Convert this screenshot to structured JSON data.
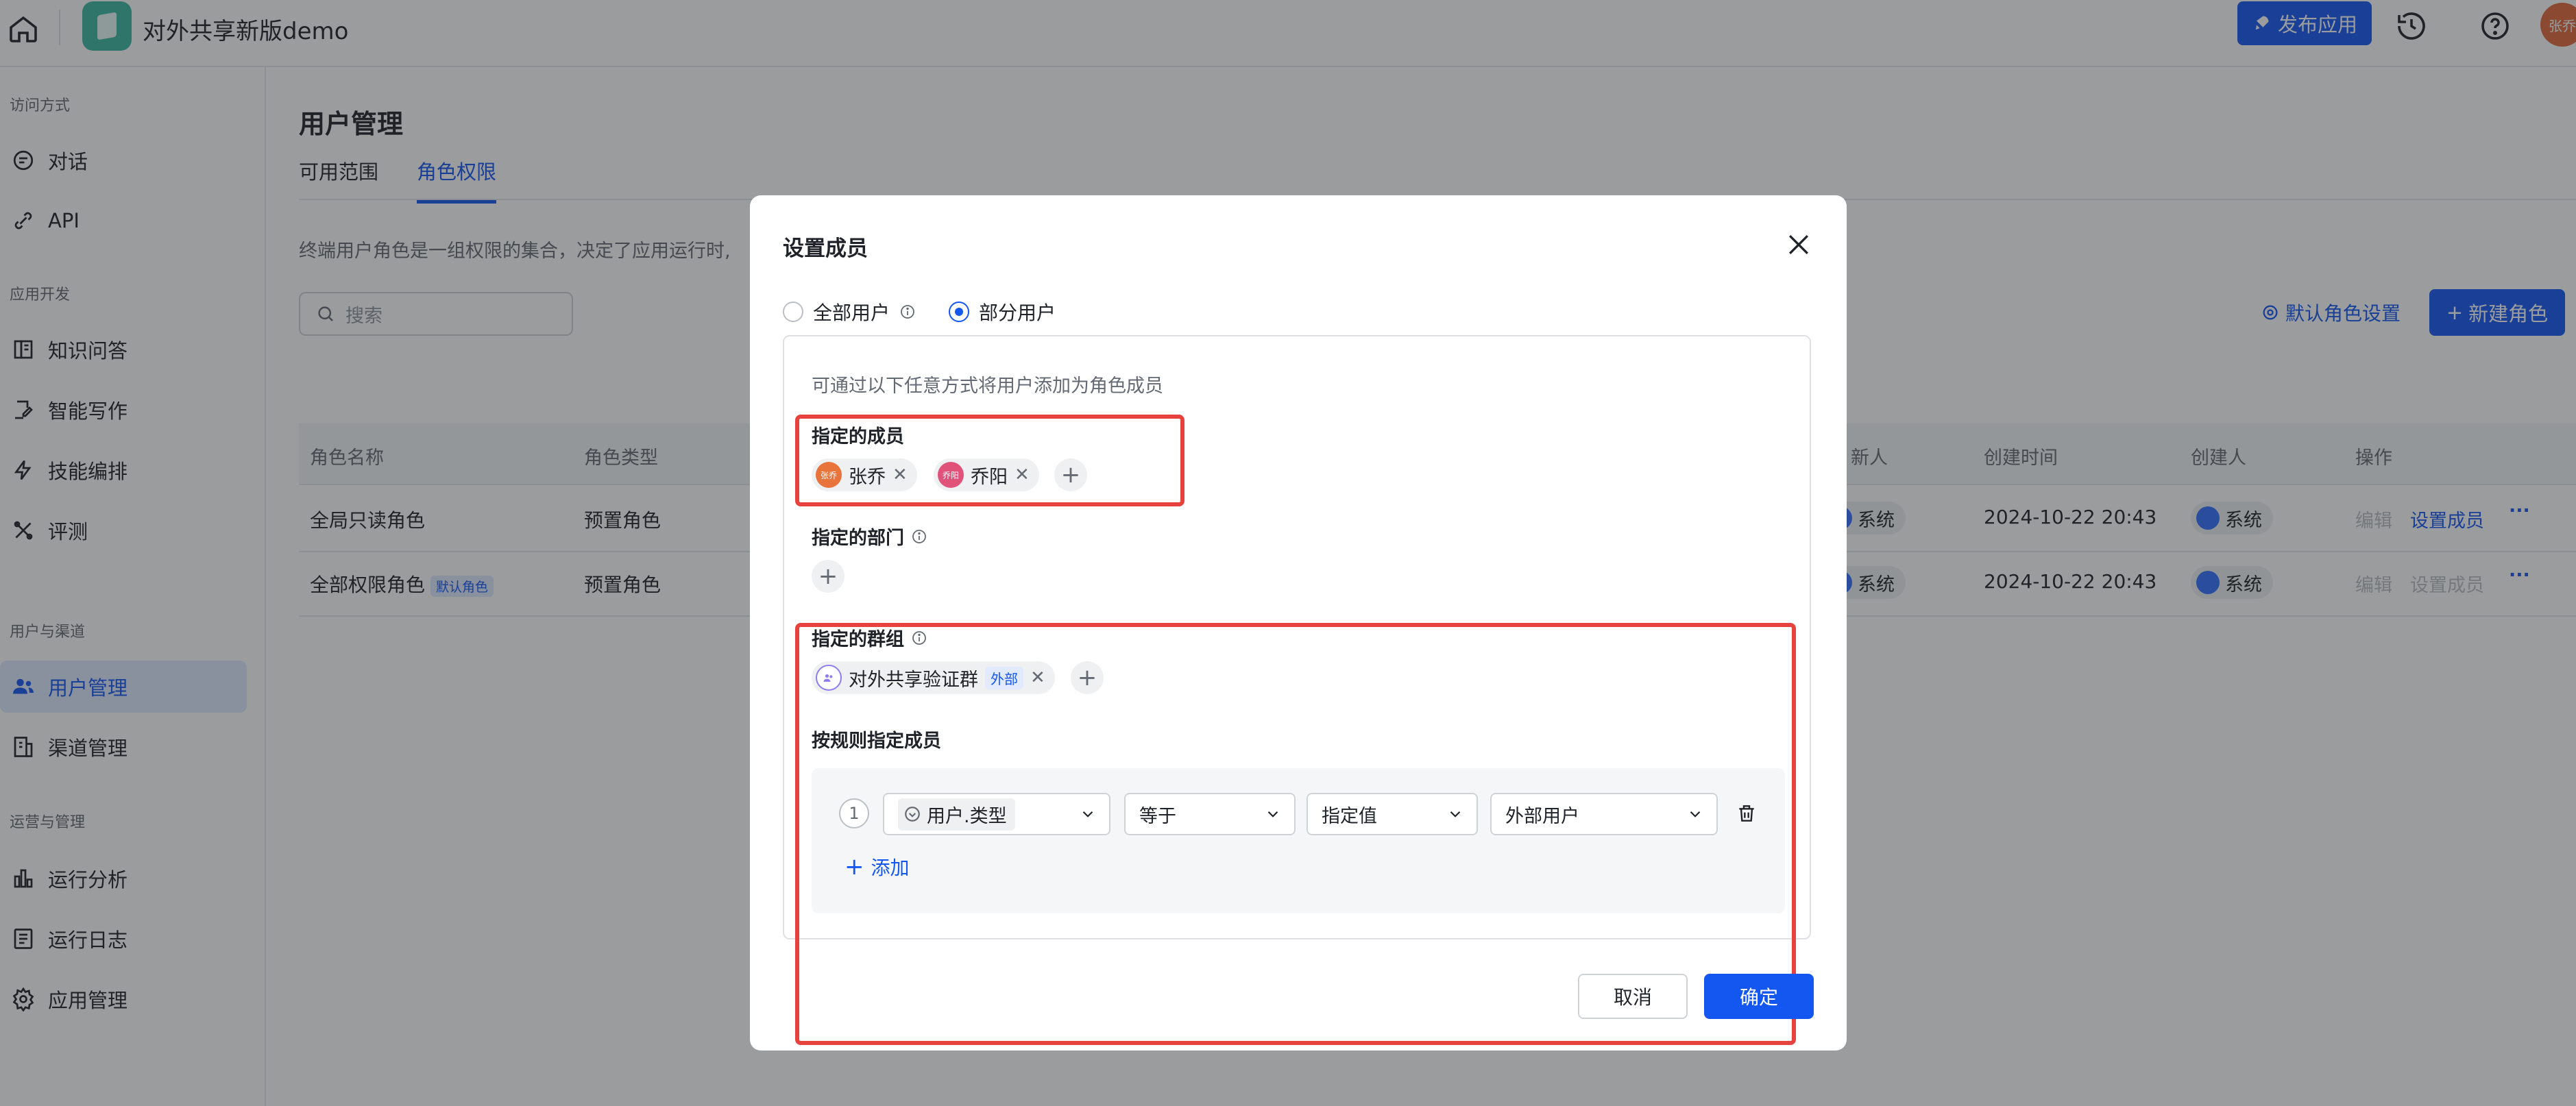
{
  "topbar": {
    "app_name": "对外共享新版demo",
    "publish_label": "发布应用",
    "user_avatar_text": "张乔"
  },
  "sidebar": {
    "groups": [
      "访问方式",
      "应用开发",
      "用户与渠道",
      "运营与管理"
    ],
    "items": [
      {
        "label": "对话",
        "icon": "chat-icon"
      },
      {
        "label": "API",
        "icon": "api-icon"
      },
      {
        "label": "知识问答",
        "icon": "book-icon"
      },
      {
        "label": "智能写作",
        "icon": "edit-icon"
      },
      {
        "label": "技能编排",
        "icon": "bolt-icon"
      },
      {
        "label": "评测",
        "icon": "tools-icon"
      },
      {
        "label": "用户管理",
        "icon": "users-icon"
      },
      {
        "label": "渠道管理",
        "icon": "channel-icon"
      },
      {
        "label": "运行分析",
        "icon": "bar-chart-icon"
      },
      {
        "label": "运行日志",
        "icon": "log-icon"
      },
      {
        "label": "应用管理",
        "icon": "gear-icon"
      }
    ]
  },
  "main": {
    "title": "用户管理",
    "tabs": [
      "可用范围",
      "角色权限"
    ],
    "description": "终端用户角色是一组权限的集合，决定了应用运行时,",
    "search_placeholder": "搜索",
    "default_role_label": "默认角色设置",
    "new_role_label": "新建角色",
    "columns": [
      "角色名称",
      "角色类型",
      "新人",
      "创建时间",
      "创建人",
      "操作"
    ],
    "rows": [
      {
        "name": "全局只读角色",
        "type": "预置角色",
        "updater": "系统",
        "created": "2024-10-22 20:43",
        "creator": "系统",
        "edit": "编辑",
        "set_member": "设置成员"
      },
      {
        "name": "全部权限角色",
        "badge": "默认角色",
        "type": "预置角色",
        "updater": "系统",
        "created": "2024-10-22 20:43",
        "creator": "系统",
        "edit": "编辑",
        "set_member": "设置成员"
      }
    ],
    "more": "···"
  },
  "modal": {
    "title": "设置成员",
    "radio_all": "全部用户",
    "radio_partial": "部分用户",
    "selected_radio": "部分用户",
    "tip": "可通过以下任意方式将用户添加为角色成员",
    "members_label": "指定的成员",
    "members": [
      {
        "name": "张乔",
        "avatar": "张乔",
        "color": "#e8743b"
      },
      {
        "name": "乔阳",
        "avatar": "乔阳",
        "color": "#e0527a"
      }
    ],
    "departments_label": "指定的部门",
    "groups_label": "指定的群组",
    "groups": [
      {
        "name": "对外共享验证群",
        "badge": "外部"
      }
    ],
    "rules_label": "按规则指定成员",
    "rule": {
      "index": "1",
      "field": "用户.类型",
      "operator": "等于",
      "value_type": "指定值",
      "value": "外部用户"
    },
    "add_label": "添加",
    "cancel_label": "取消",
    "ok_label": "确定",
    "highlight_color": "#e8423f"
  },
  "colors": {
    "accent": "#1456f0",
    "overlay": "rgba(31,35,41,0.45)"
  }
}
